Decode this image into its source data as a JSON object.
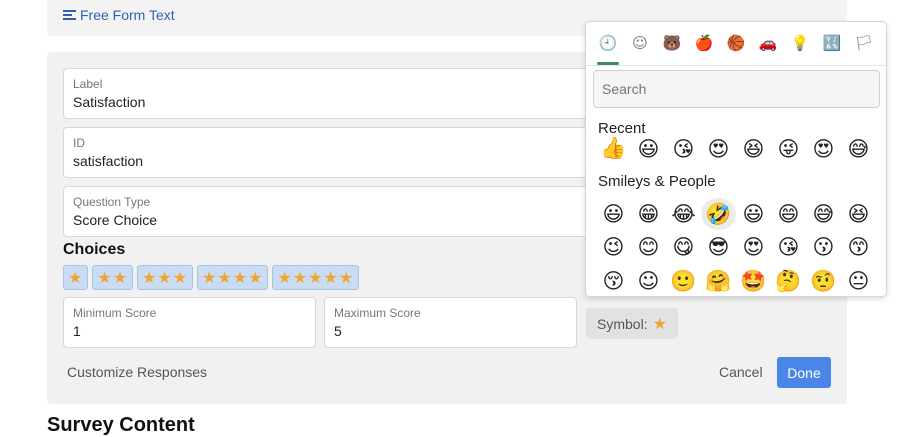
{
  "top_link": {
    "label": "Free Form Text"
  },
  "fields": {
    "label": {
      "label": "Label",
      "value": "Satisfaction"
    },
    "id": {
      "label": "ID",
      "value": "satisfaction"
    },
    "question_type": {
      "label": "Question Type",
      "value": "Score Choice"
    },
    "min_score": {
      "label": "Minimum Score",
      "value": "1"
    },
    "max_score": {
      "label": "Maximum Score",
      "value": "5"
    }
  },
  "choices": {
    "title": "Choices",
    "chips": [
      "★",
      "★★",
      "★★★",
      "★★★★",
      "★★★★★"
    ]
  },
  "symbol": {
    "label": "Symbol:",
    "value": "★"
  },
  "actions": {
    "customize": "Customize Responses",
    "cancel": "Cancel",
    "done": "Done"
  },
  "bottom_heading": "Survey Content",
  "picker": {
    "categories": [
      {
        "name": "recent",
        "glyph": "🕘"
      },
      {
        "name": "smileys",
        "glyph": "☺"
      },
      {
        "name": "animals",
        "glyph": "🐻"
      },
      {
        "name": "food",
        "glyph": "🍎"
      },
      {
        "name": "activity",
        "glyph": "🏀"
      },
      {
        "name": "travel",
        "glyph": "🚗"
      },
      {
        "name": "objects",
        "glyph": "💡"
      },
      {
        "name": "symbols",
        "glyph": "🔣"
      },
      {
        "name": "flags",
        "glyph": "🏳"
      }
    ],
    "search_placeholder": "Search",
    "recent_title": "Recent",
    "recent": [
      "👍",
      "😃",
      "😘",
      "😍",
      "😆",
      "😜",
      "😍",
      "😅"
    ],
    "smileys_title": "Smileys & People",
    "smileys_rows": [
      [
        "😃",
        "😁",
        "😂",
        "🤣",
        "😃",
        "😄",
        "😅",
        "😆"
      ],
      [
        "😉",
        "😊",
        "😋",
        "😎",
        "😍",
        "😘",
        "😗",
        "😙"
      ],
      [
        "😚",
        "☺",
        "🙂",
        "🤗",
        "🤩",
        "🤔",
        "🤨",
        "😐"
      ]
    ]
  },
  "colors": {
    "accent": "#4a86e8",
    "star": "#f1a52f",
    "link": "#2f5fb3",
    "active_tab": "#3a8e5e"
  }
}
